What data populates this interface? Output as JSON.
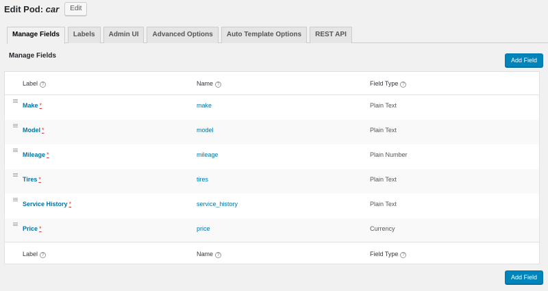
{
  "header": {
    "title_prefix": "Edit Pod:",
    "pod_name": "car",
    "edit_label": "Edit"
  },
  "tabs": [
    {
      "label": "Manage Fields",
      "active": true
    },
    {
      "label": "Labels",
      "active": false
    },
    {
      "label": "Admin UI",
      "active": false
    },
    {
      "label": "Advanced Options",
      "active": false
    },
    {
      "label": "Auto Template Options",
      "active": false
    },
    {
      "label": "REST API",
      "active": false
    }
  ],
  "section_title": "Manage Fields",
  "add_field_label": "Add Field",
  "table": {
    "columns": {
      "label": "Label",
      "name": "Name",
      "type": "Field Type"
    },
    "help_glyph": "?",
    "required_mark": "*",
    "rows": [
      {
        "label": "Make",
        "name": "make",
        "type": "Plain Text"
      },
      {
        "label": "Model",
        "name": "model",
        "type": "Plain Text"
      },
      {
        "label": "Mileage",
        "name": "mileage",
        "type": "Plain Number"
      },
      {
        "label": "Tires",
        "name": "tires",
        "type": "Plain Text"
      },
      {
        "label": "Service History",
        "name": "service_history",
        "type": "Plain Text"
      },
      {
        "label": "Price",
        "name": "price",
        "type": "Currency"
      }
    ]
  },
  "colors": {
    "primary": "#0085ba",
    "link": "#0073aa",
    "required": "#dc3232",
    "background": "#f1f1f1"
  }
}
